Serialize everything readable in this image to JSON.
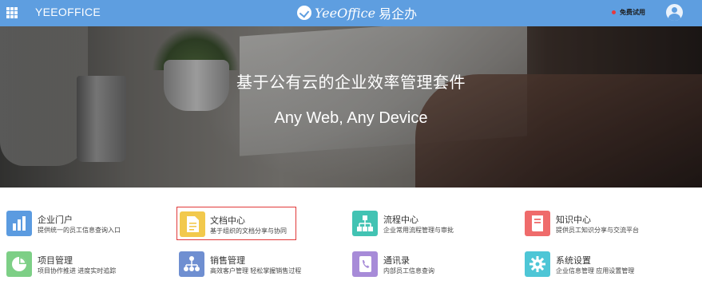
{
  "header": {
    "app_name": "YEEOFFICE",
    "brand_en": "YeeOffice",
    "brand_cn": "易企办",
    "trial_label": "免费试用",
    "colors": {
      "bar": "#5e9ee0",
      "trial_dot": "#e8383d"
    }
  },
  "hero": {
    "title": "基于公有云的企业效率管理套件",
    "subtitle": "Any Web, Any Device"
  },
  "modules": [
    {
      "title": "企业门户",
      "desc": "提供统一的员工信息查询入口",
      "icon": "portal-chart-icon",
      "color": "#5b9be0"
    },
    {
      "title": "文档中心",
      "desc": "基于组织的文档分享与协同",
      "icon": "document-icon",
      "color": "#f2c94c"
    },
    {
      "title": "流程中心",
      "desc": "企业常用流程管理与审批",
      "icon": "workflow-icon",
      "color": "#42c3b3"
    },
    {
      "title": "知识中心",
      "desc": "提供员工知识分享与交流平台",
      "icon": "book-icon",
      "color": "#ef6b6b"
    },
    {
      "title": "项目管理",
      "desc": "项目协作推进 进度实时追踪",
      "icon": "pie-chart-icon",
      "color": "#7dcf86"
    },
    {
      "title": "销售管理",
      "desc": "高效客户管理 轻松掌握销售过程",
      "icon": "sales-org-icon",
      "color": "#6f8fd1"
    },
    {
      "title": "通讯录",
      "desc": "内部员工信息查询",
      "icon": "contacts-phone-icon",
      "color": "#a78bd8"
    },
    {
      "title": "系统设置",
      "desc": "企业信息管理 应用设置管理",
      "icon": "gear-icon",
      "color": "#4ec6d6"
    }
  ]
}
